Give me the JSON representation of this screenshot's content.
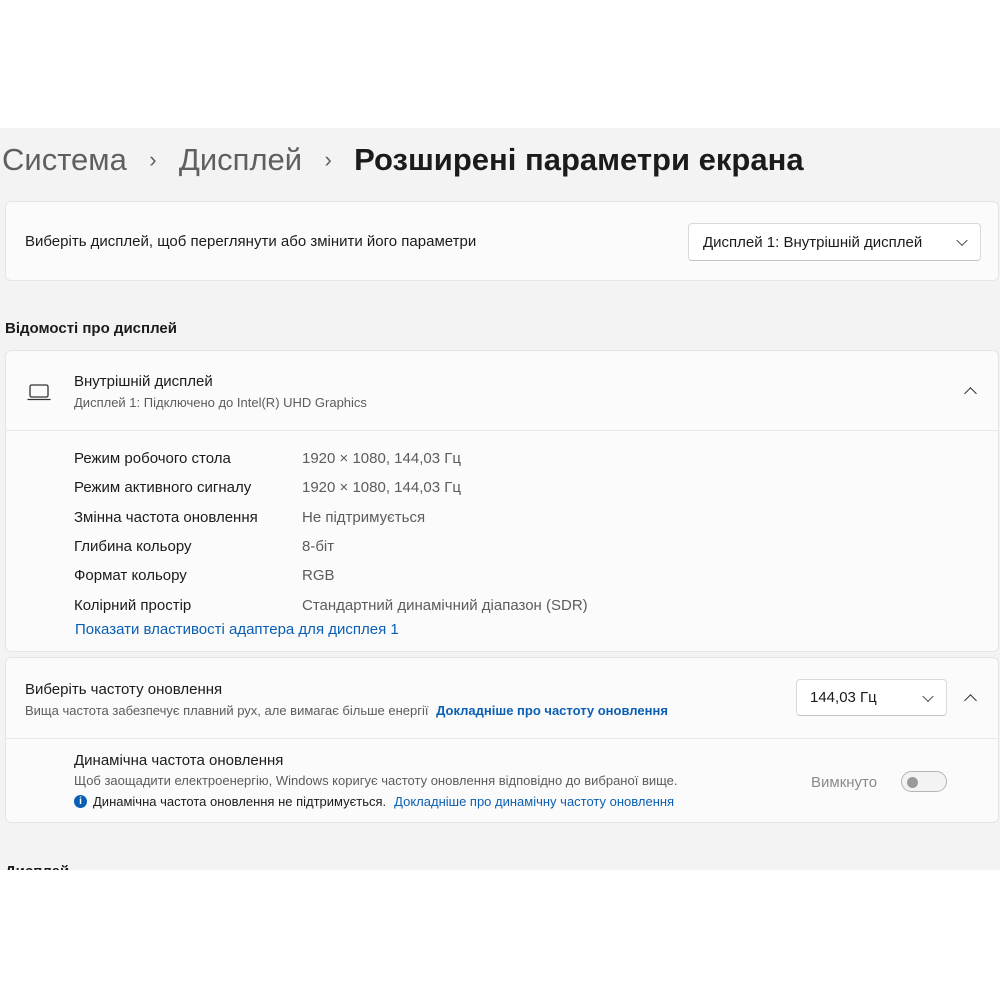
{
  "breadcrumb": {
    "items": [
      "Система",
      "Дисплей"
    ],
    "current": "Розширені параметри екрана",
    "separator": "›"
  },
  "display_select": {
    "label": "Виберіть дисплей, щоб переглянути або змінити його параметри",
    "selected": "Дисплей 1: Внутрішній дисплей"
  },
  "info_section": {
    "title": "Відомості про дисплей",
    "device_title": "Внутрішній дисплей",
    "device_subtitle": "Дисплей 1: Підключено до Intel(R) UHD Graphics",
    "rows": [
      {
        "label": "Режим робочого стола",
        "value": "1920 × 1080, 144,03 Гц"
      },
      {
        "label": "Режим активного сигналу",
        "value": "1920 × 1080, 144,03 Гц"
      },
      {
        "label": "Змінна частота оновлення",
        "value": "Не підтримується"
      },
      {
        "label": "Глибина кольору",
        "value": "8-біт"
      },
      {
        "label": "Формат кольору",
        "value": "RGB"
      },
      {
        "label": "Колірний простір",
        "value": "Стандартний динамічний діапазон (SDR)"
      }
    ],
    "adapter_link": "Показати властивості адаптера для дисплея 1"
  },
  "refresh_rate": {
    "title": "Виберіть частоту оновлення",
    "subtitle": "Вища частота забезпечує плавний рух, але вимагає більше енергії",
    "learn_more": "Докладніше про частоту оновлення",
    "selected": "144,03 Гц",
    "dynamic": {
      "title": "Динамічна частота оновлення",
      "description": "Щоб заощадити електроенергію, Windows коригує частоту оновлення відповідно до вибраної вище.",
      "note": "Динамічна частота оновлення не підтримується.",
      "note_link": "Докладніше про динамічну частоту оновлення",
      "toggle_state": "Вимкнуто",
      "toggle_on": false
    }
  },
  "next_section": {
    "title_partial": "Дисплей"
  },
  "colors": {
    "accent": "#0a5fb4",
    "background": "#f3f3f3",
    "card": "#fbfbfb"
  }
}
